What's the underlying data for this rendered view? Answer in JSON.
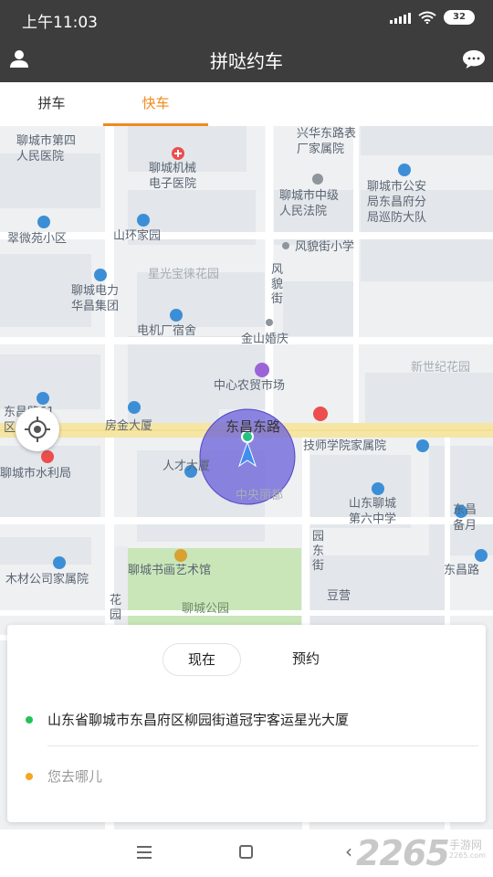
{
  "status_bar": {
    "time": "上午11:03",
    "battery": "32"
  },
  "header": {
    "title": "拼哒约车"
  },
  "tabs": [
    {
      "label": "拼车",
      "active": false
    },
    {
      "label": "快车",
      "active": true
    }
  ],
  "accent_color": "#f08a1e",
  "map": {
    "pois": [
      {
        "text": "聊城市第四\n人民医院"
      },
      {
        "text": "兴华东路表\n厂家属院"
      },
      {
        "text": "聊城机械\n电子医院"
      },
      {
        "text": "聊城市公安\n局东昌府分\n局巡防大队"
      },
      {
        "text": "聊城市中级\n人民法院"
      },
      {
        "text": "翠微苑小区"
      },
      {
        "text": "山环家园"
      },
      {
        "text": "风貌街小学"
      },
      {
        "text": "星光宝徕花园"
      },
      {
        "text": "聊城电力\n华昌集团"
      },
      {
        "text": "电机厂宿舍"
      },
      {
        "text": "金山婚庆"
      },
      {
        "text": "新世纪花园"
      },
      {
        "text": "中心农贸市场"
      },
      {
        "text": "东昌路61\n区"
      },
      {
        "text": "房金大厦"
      },
      {
        "text": "东昌东路"
      },
      {
        "text": "技师学院家属院"
      },
      {
        "text": "聊城市水利局"
      },
      {
        "text": "人才大厦"
      },
      {
        "text": "中央丽都"
      },
      {
        "text": "山东聊城\n第六中学"
      },
      {
        "text": "东昌\n备月"
      },
      {
        "text": "东昌路"
      },
      {
        "text": "木材公司家属院"
      },
      {
        "text": "聊城书画艺术馆"
      },
      {
        "text": "豆营"
      },
      {
        "text": "聊城公园"
      }
    ],
    "vertical_streets": [
      {
        "text": "风貌街"
      },
      {
        "text": "园东街"
      },
      {
        "text": "花园"
      }
    ]
  },
  "panel": {
    "mode_now": "现在",
    "mode_later": "预约",
    "from_address": "山东省聊城市东昌府区柳园街道冠宇客运星光大厦",
    "to_placeholder": "您去哪儿"
  },
  "watermark": {
    "brand": "2265",
    "cn": "手游网",
    "en": "2265.com"
  }
}
